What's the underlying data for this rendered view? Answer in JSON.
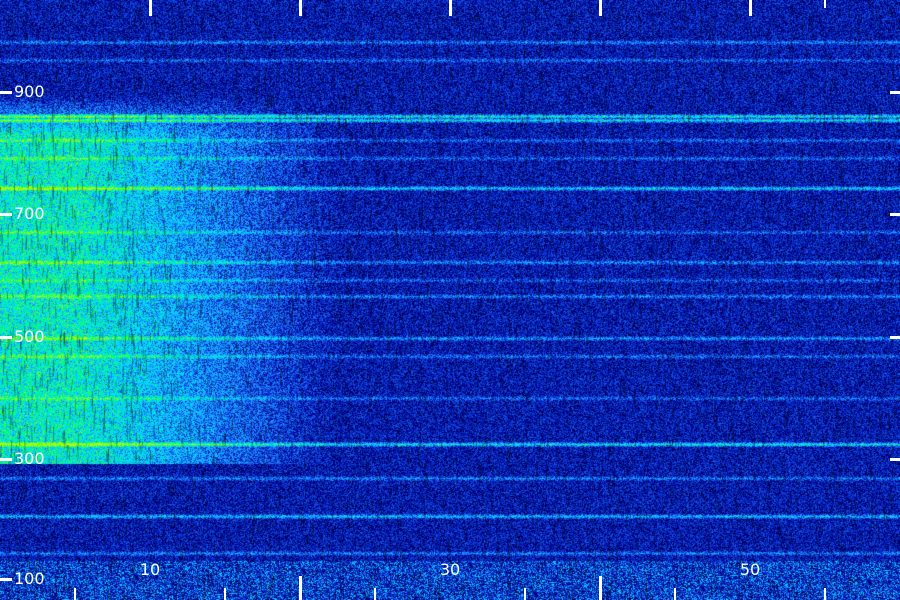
{
  "spectrogram": {
    "y_axis_labels": [
      "900",
      "700",
      "500",
      "300",
      "100"
    ],
    "x_axis_labels": [
      "10",
      "30",
      "50"
    ],
    "colormap": [
      "#000020",
      "#00008b",
      "#0a2fd0",
      "#1e90ff",
      "#00e5ff",
      "#00ff66",
      "#b8ff00"
    ],
    "hot_region": {
      "x_max": 23,
      "y_min": 300,
      "y_max": 830
    }
  }
}
